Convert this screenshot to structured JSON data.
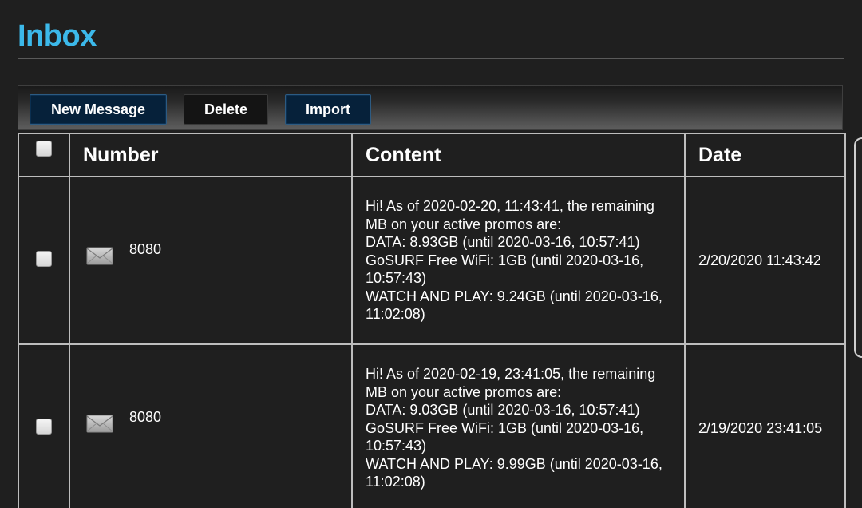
{
  "page": {
    "title": "Inbox"
  },
  "toolbar": {
    "new_message_label": "New Message",
    "delete_label": "Delete",
    "import_label": "Import"
  },
  "table": {
    "headers": {
      "number": "Number",
      "content": "Content",
      "date": "Date"
    },
    "rows": [
      {
        "checked": false,
        "icon": "envelope-icon",
        "number": "8080",
        "content_lines": [
          "Hi! As of 2020-02-20, 11:43:41, the remaining",
          "MB on your active promos are:",
          "DATA: 8.93GB (until 2020-03-16, 10:57:41)",
          "GoSURF Free WiFi: 1GB (until 2020-03-16,",
          "10:57:43)",
          "WATCH AND PLAY: 9.24GB (until 2020-03-16,",
          "11:02:08)"
        ],
        "date": "2/20/2020 11:43:42"
      },
      {
        "checked": false,
        "icon": "envelope-icon",
        "number": "8080",
        "content_lines": [
          "Hi! As of 2020-02-19, 23:41:05, the remaining",
          "MB on your active promos are:",
          "DATA: 9.03GB (until 2020-03-16, 10:57:41)",
          "GoSURF Free WiFi: 1GB (until 2020-03-16,",
          "10:57:43)",
          "WATCH AND PLAY: 9.99GB (until 2020-03-16,",
          "11:02:08)"
        ],
        "date": "2/19/2020 23:41:05"
      }
    ]
  },
  "colors": {
    "background": "#1f1f1f",
    "title": "#3cb9ea",
    "button_blue": "#06213a",
    "button_dark": "#141414",
    "table_border": "#bdbdbd"
  }
}
